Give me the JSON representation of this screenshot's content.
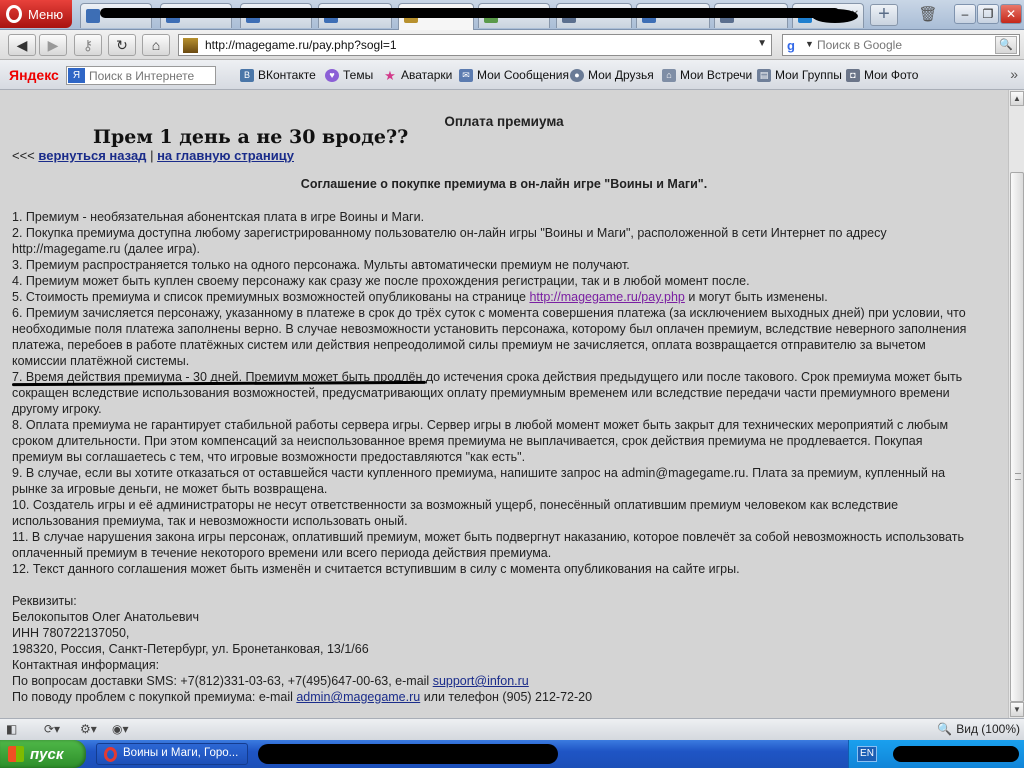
{
  "browser": {
    "menu_label": "Меню",
    "address_url": "http://magegame.ru/pay.php?sogl=1",
    "search_placeholder": "Поиск в Google",
    "status_zoom": "Вид (100%)"
  },
  "bookmarks": {
    "brand": "Яндекс",
    "search_placeholder": "Поиск в Интернете",
    "items": [
      "ВКонтакте",
      "Темы",
      "Аватарки",
      "Мои Сообщения",
      "Мои Друзья",
      "Мои Встречи",
      "Мои Группы",
      "Мои Фото"
    ]
  },
  "page": {
    "heading": "Оплата премиума",
    "annotation": "Прем 1 день а не 30 вроде??",
    "back_prefix": "<<<",
    "back_link": "вернуться назад",
    "separator": "|",
    "home_link": "на главную страницу",
    "agreement_title": "Соглашение о покупке премиума в он-лайн игре \"Воины и Маги\".",
    "items": [
      "1. Премиум - необязательная абонентская плата в игре Воины и Маги.",
      "2. Покупка премиума доступна любому зарегистрированному пользователю он-лайн игры \"Воины и Маги\", расположенной в сети Интернет по адресу http://magegame.ru (далее игра).",
      "3. Премиум распространяется только на одного персонажа. Мульты автоматически премиум не получают.",
      "4. Премиум может быть куплен своему персонажу как сразу же после прохождения регистрации, так и в любой момент после.",
      "6. Премиум зачисляется персонажу, указанному в платеже в срок до трёх суток с момента совершения платежа (за исключением выходных дней) при условии, что необходимые поля платежа заполнены верно. В случае невозможности установить персонажа, которому был оплачен премиум, вследствие неверного заполнения платежа, перебоев в работе платёжных систем или действия непреодолимой силы премиум не зачисляется, оплата возвращается отправителю за вычетом комиссии платёжной системы.",
      "7. Время действия премиума - 30 дней. Премиум может быть продлён до истечения срока действия предыдущего или после такового. Срок премиума может быть сокращен вследствие использования возможностей, предусматривающих оплату премиумным временем или вследствие передачи части премиумного времени другому игроку.",
      "8. Оплата премиума не гарантирует стабильной работы сервера игры. Сервер игры в любой момент может быть закрыт для технических мероприятий с любым сроком длительности. При этом компенсаций за неиспользованное время премиума не выплачивается, срок действия премиума не продлевается. Покупая премиум вы соглашаетесь с тем, что игровые возможности предоставляются \"как есть\".",
      "9. В случае, если вы хотите отказаться от оставшейся части купленного премиума, напишите запрос на admin@magegame.ru. Плата за премиум, купленный на рынке за игровые деньги, не может быть возвращена.",
      "10. Создатель игры и её администраторы не несут ответственности за возможный ущерб, понесённый оплатившим премиум человеком как вследствие использования премиума, так и невозможности использовать оный.",
      "11. В случае нарушения закона игры персонаж, оплативший премиум, может быть подвергнут наказанию, которое повлечёт за собой невозможность использовать оплаченный премиум в течение некоторого времени или всего периода действия премиума.",
      "12. Текст данного соглашения может быть изменён и считается вступившим в силу с момента опубликования на сайте игры."
    ],
    "item5": {
      "before": "5. Стоимость премиума и список премиумных возможностей опубликованы на странице ",
      "link": "http://magegame.ru/pay.php",
      "after": " и могут быть изменены."
    },
    "requisites": {
      "title": "Реквизиты:",
      "name": "Белокопытов Олег Анатольевич",
      "inn": "ИНН 780722137050,",
      "address": "198320, Россия, Санкт-Петербург, ул. Бронетанковая, 13/1/66",
      "contact_title": "Контактная информация:",
      "sms_before": "По вопросам доставки SMS: +7(812)331-03-63, +7(495)647-00-63, e-mail ",
      "sms_email": "support@infon.ru",
      "premium_before": "По поводу проблем с покупкой премиума: e-mail ",
      "premium_email": "admin@magegame.ru",
      "premium_after": " или телефон (905) 212-72-20"
    }
  },
  "taskbar": {
    "start_label": "пуск",
    "task_title": "Воины и Маги, Горо...",
    "lang": "EN"
  },
  "colors": {
    "page_bg": "#d4d4d4",
    "link": "#1a2c8a",
    "visited_link": "#7a1fa2"
  }
}
